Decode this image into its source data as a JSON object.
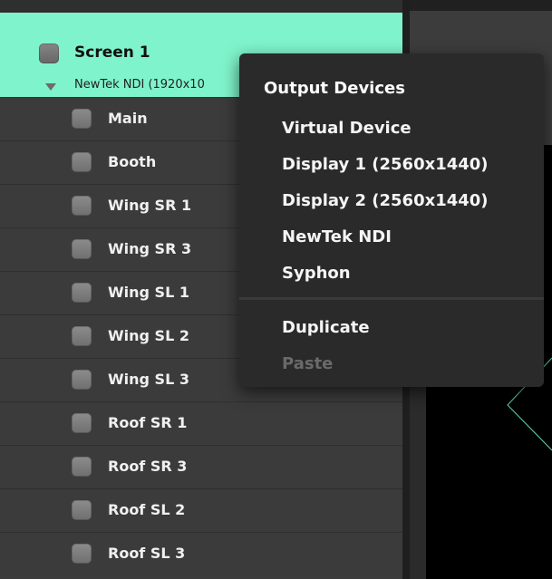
{
  "screen": {
    "title": "Screen 1",
    "subtitle": "NewTek NDI (1920x10"
  },
  "layers": [
    {
      "label": "Main"
    },
    {
      "label": "Booth"
    },
    {
      "label": "Wing SR 1"
    },
    {
      "label": "Wing SR 3"
    },
    {
      "label": "Wing SL 1"
    },
    {
      "label": "Wing SL 2"
    },
    {
      "label": "Wing SL 3"
    },
    {
      "label": "Roof SR 1"
    },
    {
      "label": "Roof SR 3"
    },
    {
      "label": "Roof SL 2"
    },
    {
      "label": "Roof SL 3"
    }
  ],
  "context_menu": {
    "header": "Output Devices",
    "items": [
      {
        "label": "Virtual Device"
      },
      {
        "label": "Display 1 (2560x1440)"
      },
      {
        "label": "Display 2 (2560x1440)"
      },
      {
        "label": "NewTek NDI"
      },
      {
        "label": "Syphon"
      }
    ],
    "actions": [
      {
        "label": "Duplicate",
        "enabled": true
      },
      {
        "label": "Paste",
        "enabled": false
      }
    ]
  },
  "colors": {
    "selected_row": "#7ff3cb",
    "guide_line": "#5fd6b5"
  }
}
